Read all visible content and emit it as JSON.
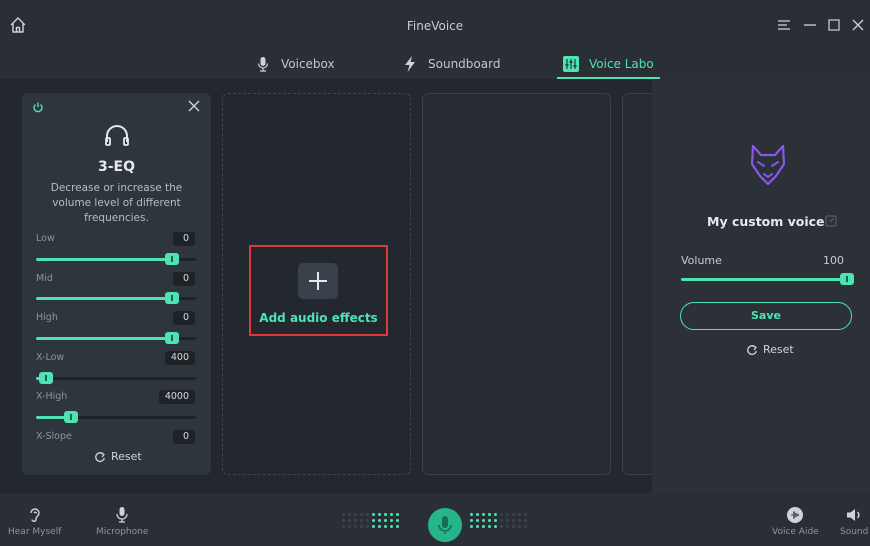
{
  "app": {
    "title": "FineVoice"
  },
  "tabs": [
    {
      "label": "Voicebox",
      "icon": "microphone-icon",
      "active": false
    },
    {
      "label": "Soundboard",
      "icon": "lightning-icon",
      "active": false
    },
    {
      "label": "Voice Labo",
      "icon": "mixer-icon",
      "active": true
    }
  ],
  "eq": {
    "name": "3-EQ",
    "description": "Decrease or increase the volume level of different frequencies.",
    "bands": [
      {
        "label": "Low",
        "value": "0",
        "level": 0.85
      },
      {
        "label": "Mid",
        "value": "0",
        "level": 0.85
      },
      {
        "label": "High",
        "value": "0",
        "level": 0.85
      },
      {
        "label": "X-Low",
        "value": "400",
        "level": 0.06
      },
      {
        "label": "X-High",
        "value": "4000",
        "level": 0.22
      },
      {
        "label": "X-Slope",
        "value": "0"
      }
    ],
    "reset_label": "Reset"
  },
  "effects": {
    "add_label": "Add audio effects"
  },
  "voice": {
    "name": "My custom voice",
    "volume_label": "Volume",
    "volume_value": "100",
    "volume_level": 1.0,
    "save_label": "Save",
    "reset_label": "Reset"
  },
  "bottom": {
    "hear_myself": "Hear Myself",
    "microphone": "Microphone",
    "voice_aide": "Voice Aide",
    "sound": "Sound"
  },
  "colors": {
    "accent": "#4ee3b3",
    "highlight": "#e0393b",
    "fox": "#8a55f0"
  }
}
